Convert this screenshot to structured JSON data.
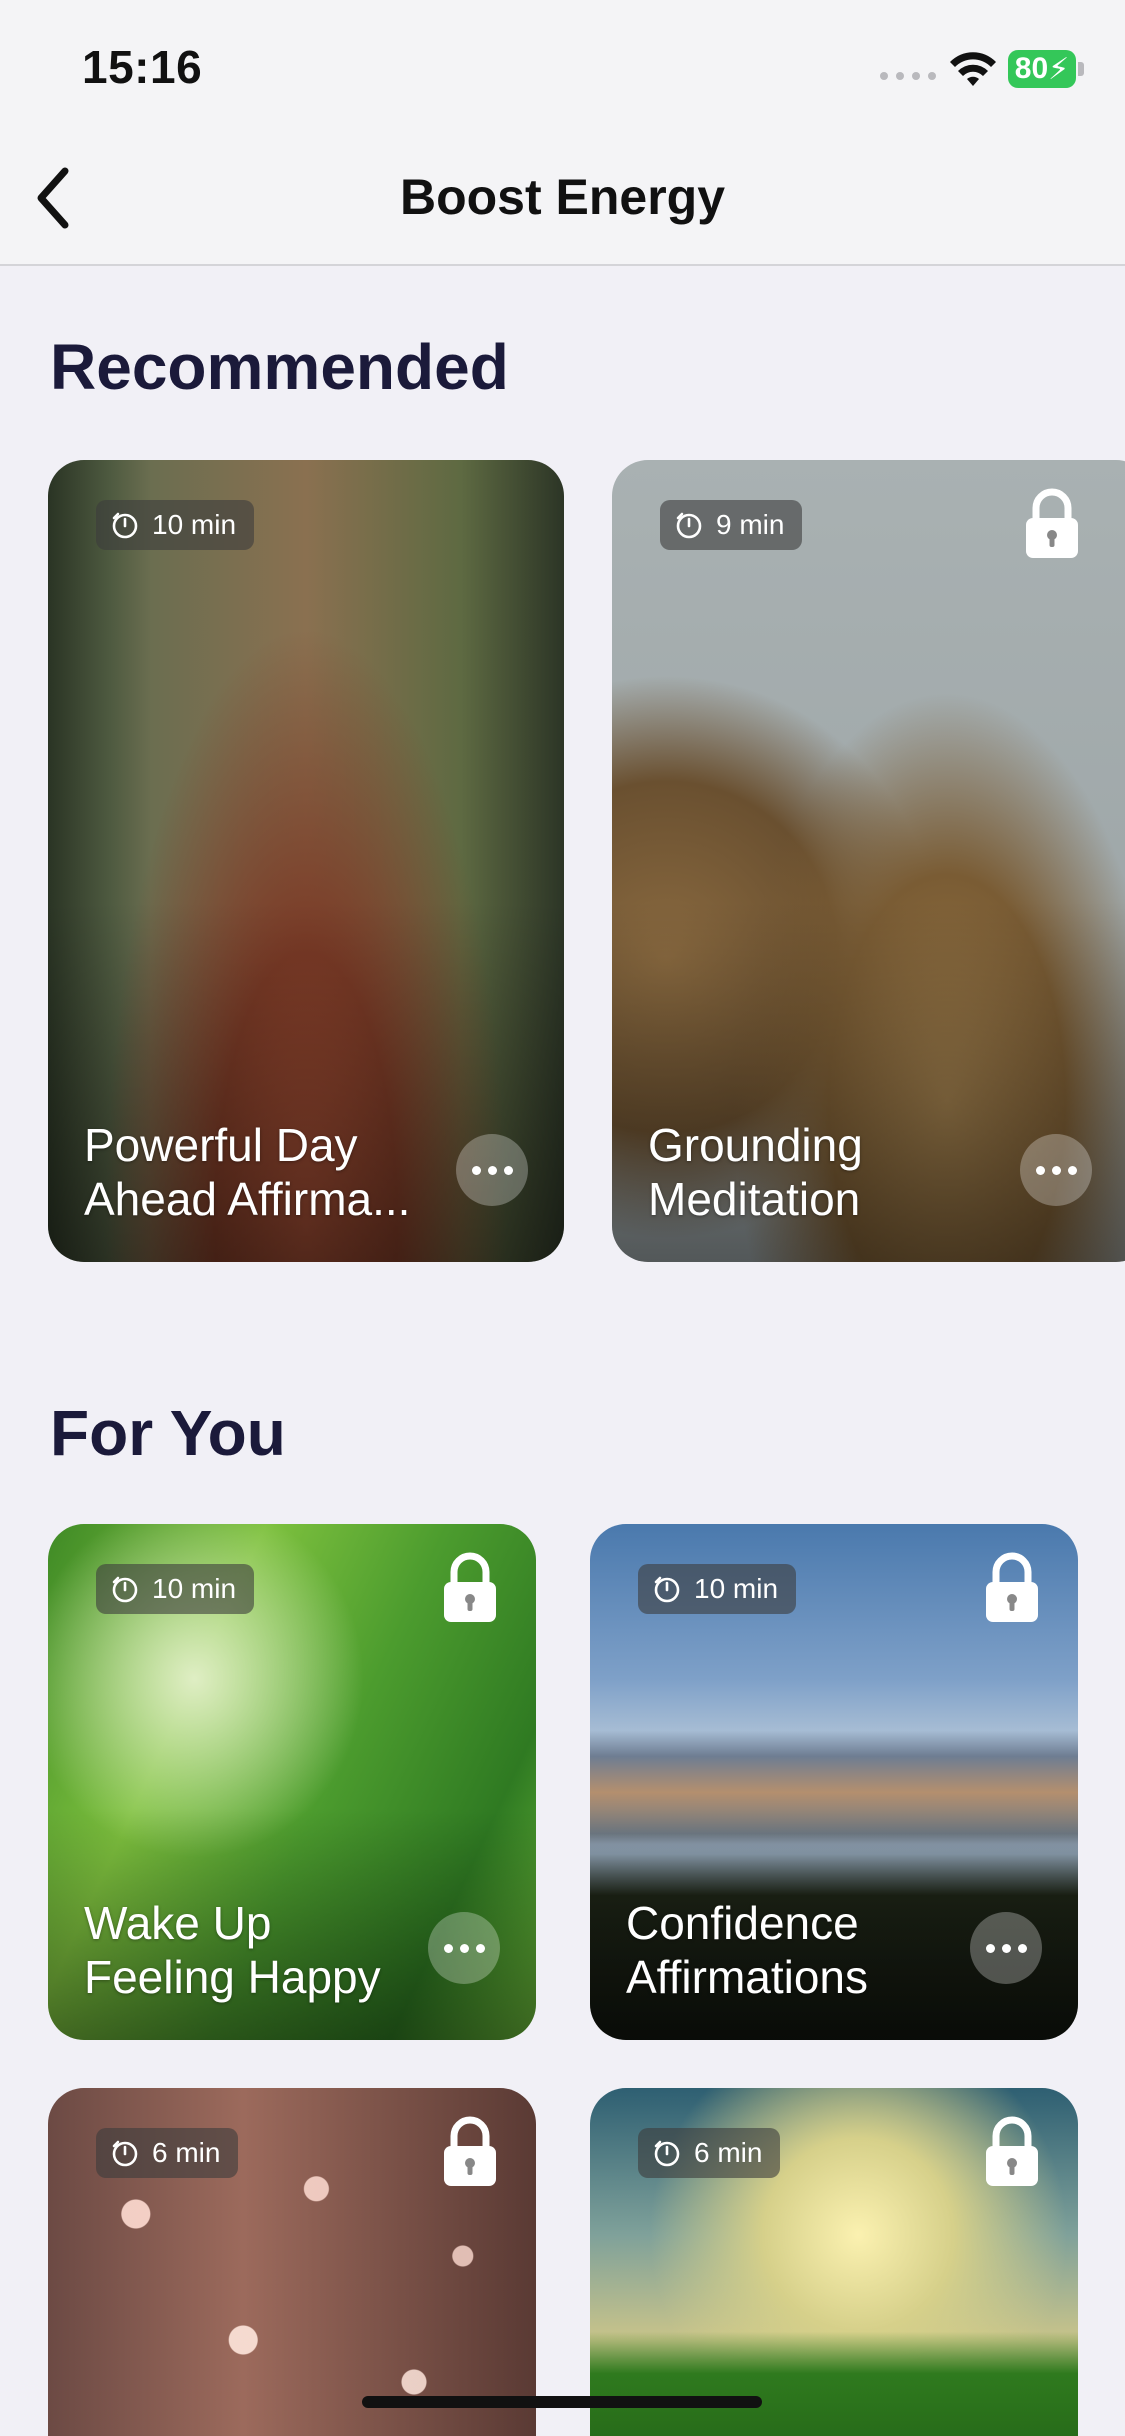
{
  "status_bar": {
    "time": "15:16",
    "battery": "80"
  },
  "nav": {
    "title": "Boost Energy"
  },
  "sections": {
    "recommended": {
      "title": "Recommended"
    },
    "for_you": {
      "title": "For You"
    }
  },
  "recommended_cards": [
    {
      "duration": "10 min",
      "title_line1": "Powerful Day",
      "title_line2": "Ahead Affirma...",
      "locked": false
    },
    {
      "duration": "9 min",
      "title_line1": "Grounding",
      "title_line2": "Meditation",
      "locked": true
    }
  ],
  "for_you_cards": [
    {
      "duration": "10 min",
      "title_line1": "Wake Up",
      "title_line2": "Feeling Happy",
      "locked": true
    },
    {
      "duration": "10 min",
      "title_line1": "Confidence",
      "title_line2": "Affirmations",
      "locked": true
    },
    {
      "duration": "6 min",
      "title_line1": "",
      "title_line2": "",
      "locked": true
    },
    {
      "duration": "6 min",
      "title_line1": "",
      "title_line2": "",
      "locked": true
    }
  ],
  "icons": {
    "back": "chevron-left-icon",
    "timer": "timer-icon",
    "lock": "lock-icon",
    "more": "ellipsis-icon",
    "wifi": "wifi-icon",
    "battery": "battery-icon"
  },
  "colors": {
    "heading": "#1b1a3a",
    "background": "#f1f0f6",
    "battery": "#34c759"
  }
}
